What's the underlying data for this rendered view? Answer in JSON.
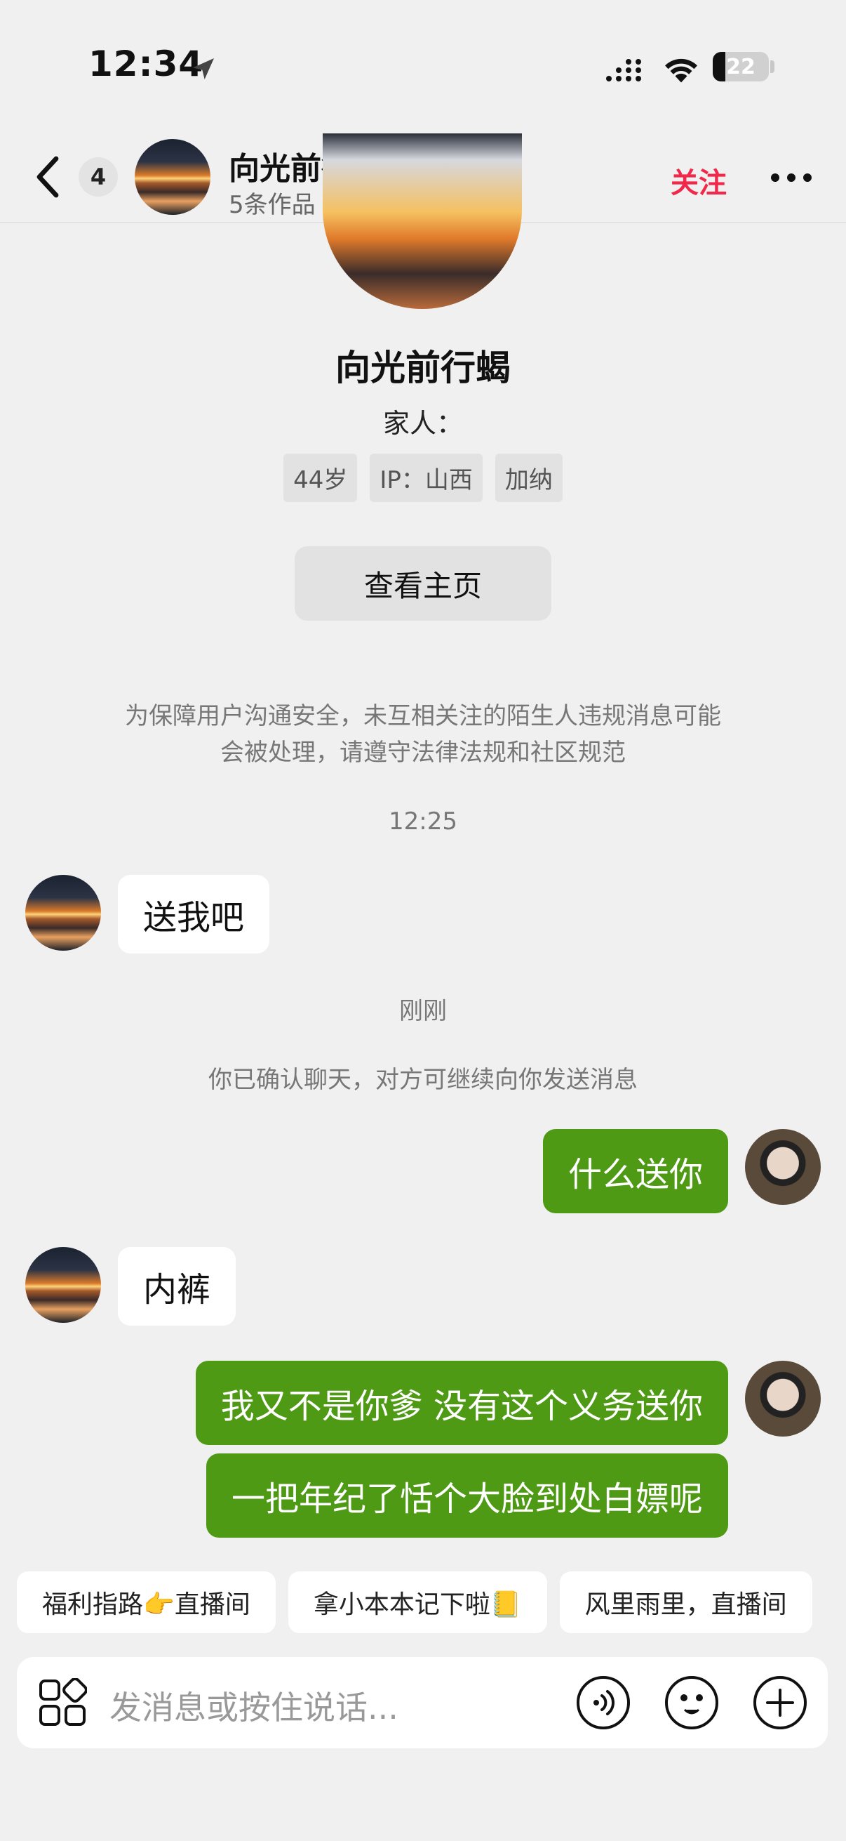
{
  "status_bar": {
    "time": "12:34",
    "battery": "22"
  },
  "header": {
    "unread_count": "4",
    "name": "向光前行蝎",
    "subtitle": "5条作品",
    "follow_label": "关注"
  },
  "profile": {
    "name": "向光前行蝎",
    "bio": "家人：",
    "tags": [
      "44岁",
      "IP：山西",
      "加纳"
    ],
    "view_home_label": "查看主页"
  },
  "chat": {
    "safety_notice_line1": "为保障用户沟通安全，未互相关注的陌生人违规消息可能",
    "safety_notice_line2": "会被处理，请遵守法律法规和社区规范",
    "time_1": "12:25",
    "time_2": "刚刚",
    "system_note": "你已确认聊天，对方可继续向你发送消息",
    "messages": [
      {
        "from": "them",
        "text": "送我吧"
      },
      {
        "from": "me",
        "text": "什么送你"
      },
      {
        "from": "them",
        "text": "内裤"
      },
      {
        "from": "me",
        "text": "我又不是你爹 没有这个义务送你"
      },
      {
        "from": "me",
        "text": "一把年纪了恬个大脸到处白嫖呢"
      }
    ]
  },
  "quick_replies": [
    "福利指路👉直播间",
    "拿小本本记下啦📒",
    "风里雨里，直播间"
  ],
  "input": {
    "placeholder": "发消息或按住说话..."
  },
  "colors": {
    "background": "#f0f0f0",
    "outgoing_bubble": "#4f9a14",
    "follow": "#f0284a"
  }
}
